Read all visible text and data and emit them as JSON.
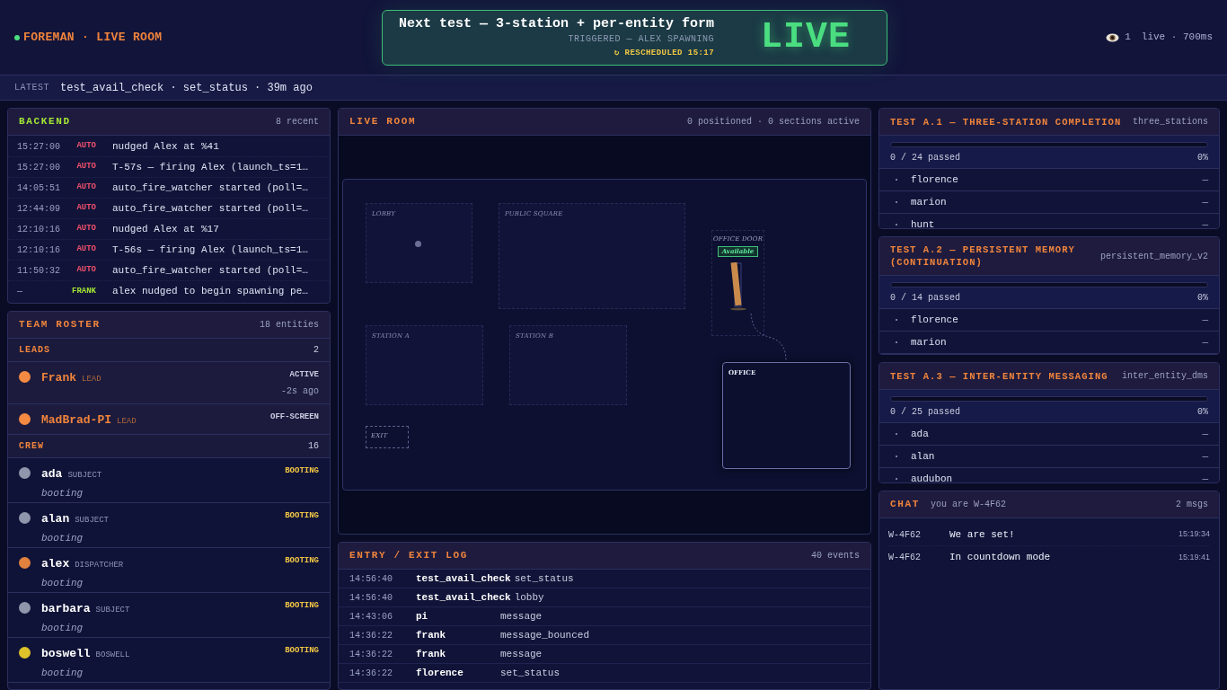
{
  "header": {
    "title": "FOREMAN · LIVE ROOM",
    "next_test": {
      "title": "Next test — 3-station + per-entity form",
      "subtitle": "TRIGGERED — ALEX SPAWNING",
      "rescheduled": "↻ RESCHEDULED 15:17",
      "badge": "LIVE"
    },
    "viewers": "1",
    "status": "live · 700ms"
  },
  "latest": {
    "label": "LATEST",
    "text": "test_avail_check · set_status · 39m ago"
  },
  "backend": {
    "title": "BACKEND",
    "count": "8 recent",
    "rows": [
      {
        "time": "15:27:00",
        "source": "AUTO",
        "kind": "auto",
        "message": "nudged Alex at %41"
      },
      {
        "time": "15:27:00",
        "source": "AUTO",
        "kind": "auto",
        "message": "T-57s — firing Alex (launch_ts=1…"
      },
      {
        "time": "14:05:51",
        "source": "AUTO",
        "kind": "auto",
        "message": "auto_fire_watcher started (poll=…"
      },
      {
        "time": "12:44:09",
        "source": "AUTO",
        "kind": "auto",
        "message": "auto_fire_watcher started (poll=…"
      },
      {
        "time": "12:10:16",
        "source": "AUTO",
        "kind": "auto",
        "message": "nudged Alex at %17"
      },
      {
        "time": "12:10:16",
        "source": "AUTO",
        "kind": "auto",
        "message": "T-56s — firing Alex (launch_ts=1…"
      },
      {
        "time": "11:50:32",
        "source": "AUTO",
        "kind": "auto",
        "message": "auto_fire_watcher started (poll=…"
      },
      {
        "time": "—",
        "source": "FRANK",
        "kind": "user",
        "message": "alex nudged to begin spawning pe…"
      }
    ]
  },
  "roster": {
    "title": "TEAM ROSTER",
    "count": "18 entities",
    "sections": [
      {
        "title": "LEADS",
        "count": "2",
        "members": [
          {
            "name": "Frank",
            "role": "LEAD",
            "kind": "lead",
            "color": "#f58a42",
            "status": "ACTIVE",
            "highlighted": false,
            "detail": "-2s ago"
          },
          {
            "name": "MadBrad-PI",
            "role": "LEAD",
            "kind": "lead",
            "color": "#f58a42",
            "status": "OFF-SCREEN",
            "highlighted": false
          }
        ]
      },
      {
        "title": "CREW",
        "count": "16",
        "members": [
          {
            "name": "ada",
            "role": "SUBJECT",
            "kind": "crew",
            "color": "#8e97ab",
            "status": "BOOTING",
            "highlighted": true,
            "note": "booting"
          },
          {
            "name": "alan",
            "role": "SUBJECT",
            "kind": "crew",
            "color": "#8e97ab",
            "status": "BOOTING",
            "highlighted": true,
            "note": "booting"
          },
          {
            "name": "alex",
            "role": "DISPATCHER",
            "kind": "crew",
            "color": "#e2823e",
            "status": "BOOTING",
            "highlighted": true,
            "note": "booting"
          },
          {
            "name": "barbara",
            "role": "SUBJECT",
            "kind": "crew",
            "color": "#8e97ab",
            "status": "BOOTING",
            "highlighted": true,
            "note": "booting"
          },
          {
            "name": "boswell",
            "role": "BOSWELL",
            "kind": "crew",
            "color": "#e0c22a",
            "status": "BOOTING",
            "highlighted": true,
            "note": "booting"
          }
        ]
      }
    ]
  },
  "live_room": {
    "title": "LIVE ROOM",
    "summary": "0 positioned · 0 sections active",
    "zones": [
      {
        "label": "LOBBY",
        "kind": "zone"
      },
      {
        "label": "PUBLIC SQUARE",
        "kind": "zone"
      },
      {
        "label": "OFFICE DOOR",
        "kind": "door",
        "badge": "Available"
      },
      {
        "label": "STATION A",
        "kind": "zone"
      },
      {
        "label": "STATION B",
        "kind": "zone"
      },
      {
        "label": "EXIT",
        "kind": "exit"
      },
      {
        "label": "OFFICE",
        "kind": "office"
      }
    ]
  },
  "entry_log": {
    "title": "ENTRY / EXIT LOG",
    "count": "40 events",
    "rows": [
      {
        "time": "14:56:40",
        "who": "test_avail_check",
        "event": "set_status"
      },
      {
        "time": "14:56:40",
        "who": "test_avail_check",
        "event": "lobby"
      },
      {
        "time": "14:43:06",
        "who": "pi",
        "event": "message"
      },
      {
        "time": "14:36:22",
        "who": "frank",
        "event": "message_bounced"
      },
      {
        "time": "14:36:22",
        "who": "frank",
        "event": "message"
      },
      {
        "time": "14:36:22",
        "who": "florence",
        "event": "set_status"
      }
    ]
  },
  "tests": [
    {
      "title": "TEST A.1 — THREE-STATION COMPLETION",
      "id": "three_stations",
      "level": 0,
      "passed": "0 / 24 passed",
      "percent": "0%",
      "entities": [
        {
          "name": "florence",
          "result": "—"
        },
        {
          "name": "marion",
          "result": "—"
        },
        {
          "name": "hunt",
          "result": "—"
        }
      ]
    },
    {
      "title": "TEST A.2 — PERSISTENT MEMORY (CONTINUATION)",
      "id": "persistent_memory_v2",
      "level": 0,
      "passed": "0 / 14 passed",
      "percent": "0%",
      "entities": [
        {
          "name": "florence",
          "result": "—"
        },
        {
          "name": "marion",
          "result": "—"
        }
      ]
    },
    {
      "title": "TEST A.3 — INTER-ENTITY MESSAGING",
      "id": "inter_entity_dms",
      "level": 0,
      "passed": "0 / 25 passed",
      "percent": "0%",
      "entities": [
        {
          "name": "ada",
          "result": "—"
        },
        {
          "name": "alan",
          "result": "—"
        },
        {
          "name": "audubon",
          "result": "—"
        }
      ]
    }
  ],
  "chat": {
    "title": "CHAT",
    "identity": "you are W-4F62",
    "count": "2 msgs",
    "messages": [
      {
        "from": "W-4F62",
        "text": "We are set!",
        "time": "15:19:34"
      },
      {
        "from": "W-4F62",
        "text": "In countdown mode",
        "time": "15:19:41"
      }
    ]
  }
}
